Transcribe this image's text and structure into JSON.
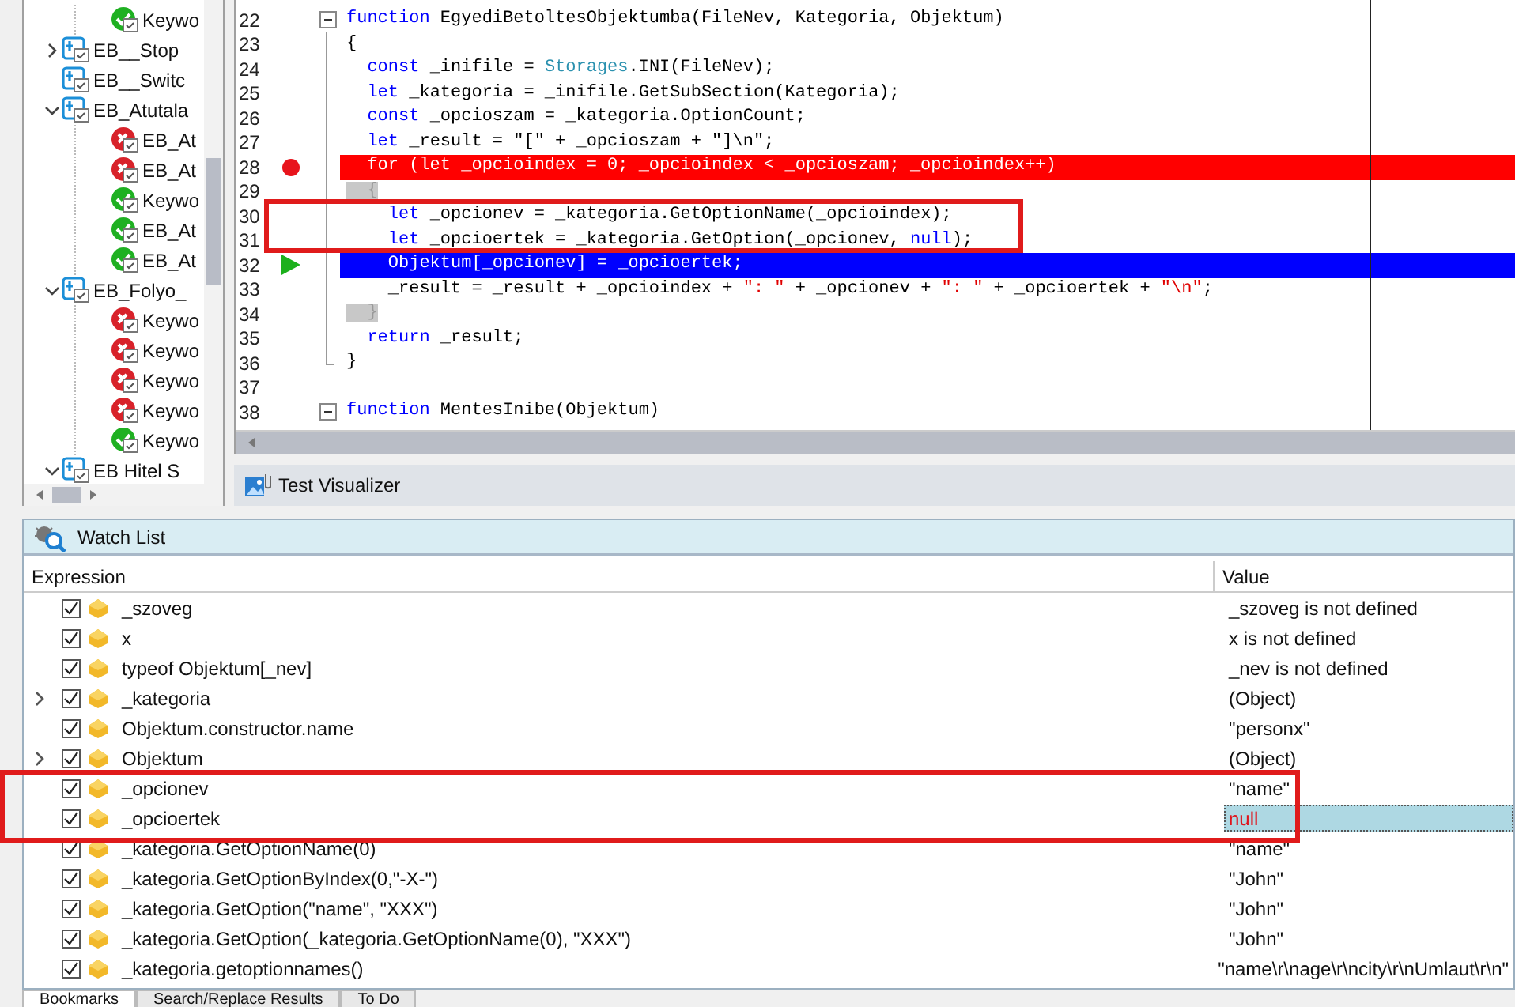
{
  "tree": {
    "continued_children": [
      {
        "label": "Keywo",
        "kind": "test",
        "failed": false
      }
    ],
    "items": [
      {
        "label": "EB__Stop",
        "kind": "group",
        "expanded": false
      },
      {
        "label": "EB__Switc",
        "kind": "group"
      },
      {
        "label": "EB_Atutala",
        "kind": "group",
        "expanded": true,
        "children": [
          {
            "label": "EB_At",
            "kind": "test",
            "failed": true
          },
          {
            "label": "EB_At",
            "kind": "test",
            "failed": true
          },
          {
            "label": "Keywo",
            "kind": "test",
            "failed": false
          },
          {
            "label": "EB_At",
            "kind": "test",
            "failed": false
          },
          {
            "label": "EB_At",
            "kind": "test",
            "failed": false
          }
        ]
      },
      {
        "label": "EB_Folyo_",
        "kind": "group",
        "expanded": true,
        "children": [
          {
            "label": "Keywo",
            "kind": "test",
            "failed": true
          },
          {
            "label": "Keywo",
            "kind": "test",
            "failed": true
          },
          {
            "label": "Keywo",
            "kind": "test",
            "failed": true
          },
          {
            "label": "Keywo",
            "kind": "test",
            "failed": true
          },
          {
            "label": "Keywo",
            "kind": "test",
            "failed": false
          }
        ]
      },
      {
        "label": "EB Hitel S",
        "kind": "group",
        "expanded": true
      }
    ]
  },
  "editor": {
    "lines": [
      {
        "number": "22",
        "fold_start": true,
        "breakpoint": false,
        "current": false,
        "tokens": [
          {
            "kind": "keyword",
            "s": "function"
          },
          {
            "kind": "plain",
            "s": " EgyediBetoltesObjektumba(FileNev, Kategoria, Objektum)"
          }
        ]
      },
      {
        "number": "23",
        "breakpoint": false,
        "current": false,
        "tokens": [
          {
            "kind": "plain",
            "s": "{"
          }
        ]
      },
      {
        "number": "24",
        "breakpoint": false,
        "current": false,
        "tokens": [
          {
            "kind": "keyword",
            "s": "  const"
          },
          {
            "kind": "plain",
            "s": " _inifile = "
          },
          {
            "kind": "type",
            "s": "Storages"
          },
          {
            "kind": "plain",
            "s": ".INI(FileNev);"
          }
        ]
      },
      {
        "number": "25",
        "breakpoint": false,
        "current": false,
        "tokens": [
          {
            "kind": "keyword",
            "s": "  let"
          },
          {
            "kind": "plain",
            "s": " _kategoria = _inifile.GetSubSection(Kategoria);"
          }
        ]
      },
      {
        "number": "26",
        "breakpoint": false,
        "current": false,
        "tokens": [
          {
            "kind": "keyword",
            "s": "  const"
          },
          {
            "kind": "plain",
            "s": " _opcioszam = _kategoria.OptionCount;"
          }
        ]
      },
      {
        "number": "27",
        "breakpoint": false,
        "current": false,
        "tokens": [
          {
            "kind": "keyword",
            "s": "  let"
          },
          {
            "kind": "plain",
            "s": " _result = \"[\" + _opcioszam + \"]\\n\";"
          }
        ]
      },
      {
        "number": "28",
        "breakpoint": true,
        "current": false,
        "tokens": [
          {
            "kind": "plain",
            "s": "  for (let _opcioindex = 0; _opcioindex < _opcioszam; _opcioindex++)"
          }
        ]
      },
      {
        "number": "29",
        "breakpoint": false,
        "current": false,
        "tokens": [
          {
            "kind": "brace",
            "s": "  {"
          }
        ]
      },
      {
        "number": "30",
        "breakpoint": false,
        "current": false,
        "framed": true,
        "tokens": [
          {
            "kind": "keyword",
            "s": "    let"
          },
          {
            "kind": "plain",
            "s": " _opcionev = _kategoria.GetOptionName(_opcioindex);"
          }
        ]
      },
      {
        "number": "31",
        "breakpoint": false,
        "current": false,
        "framed": true,
        "tokens": [
          {
            "kind": "keyword",
            "s": "    let"
          },
          {
            "kind": "plain",
            "s": " _opcioertek = _kategoria.GetOption(_opcionev, "
          },
          {
            "kind": "keyword",
            "s": "null"
          },
          {
            "kind": "plain",
            "s": ");"
          }
        ]
      },
      {
        "number": "32",
        "breakpoint": false,
        "current": true,
        "tokens": [
          {
            "kind": "plain",
            "s": "    Objektum[_opcionev] = _opcioertek;"
          }
        ]
      },
      {
        "number": "33",
        "breakpoint": false,
        "current": false,
        "tokens": [
          {
            "kind": "plain",
            "s": "    _result = _result + _opcioindex + "
          },
          {
            "kind": "string",
            "s": "\": \""
          },
          {
            "kind": "plain",
            "s": " + _opcionev + "
          },
          {
            "kind": "string",
            "s": "\": \""
          },
          {
            "kind": "plain",
            "s": " + _opcioertek + "
          },
          {
            "kind": "string",
            "s": "\"\\n\""
          },
          {
            "kind": "plain",
            "s": ";"
          }
        ]
      },
      {
        "number": "34",
        "breakpoint": false,
        "current": false,
        "tokens": [
          {
            "kind": "brace",
            "s": "  }"
          }
        ]
      },
      {
        "number": "35",
        "breakpoint": false,
        "current": false,
        "tokens": [
          {
            "kind": "keyword",
            "s": "  return"
          },
          {
            "kind": "plain",
            "s": " _result;"
          }
        ]
      },
      {
        "number": "36",
        "fold_end": true,
        "breakpoint": false,
        "current": false,
        "tokens": [
          {
            "kind": "plain",
            "s": "}"
          }
        ]
      },
      {
        "number": "37",
        "breakpoint": false,
        "current": false
      },
      {
        "number": "38",
        "fold_start": true,
        "breakpoint": false,
        "current": false,
        "tokens": [
          {
            "kind": "keyword",
            "s": "function"
          },
          {
            "kind": "plain",
            "s": " MentesInibe(Objektum)"
          }
        ]
      }
    ]
  },
  "visualizer_tab": {
    "label": "Test Visualizer"
  },
  "watch": {
    "title": "Watch List",
    "columns": [
      "Expression",
      "Value"
    ],
    "rows": [
      {
        "expression": "_szoveg",
        "value": "_szoveg is not defined",
        "kind": "text",
        "checked": true,
        "expandable": false,
        "selected": false
      },
      {
        "expression": "x",
        "value": "x is not defined",
        "kind": "text",
        "checked": true,
        "expandable": false,
        "selected": false
      },
      {
        "expression": "typeof Objektum[_nev]",
        "value": "_nev is not defined",
        "kind": "text",
        "checked": true,
        "expandable": false,
        "selected": false
      },
      {
        "expression": "_kategoria",
        "value": "(Object)",
        "kind": "text",
        "checked": true,
        "expandable": true,
        "selected": false
      },
      {
        "expression": "Objektum.constructor.name",
        "value": "\"personx\"",
        "kind": "text",
        "checked": true,
        "expandable": false,
        "selected": false
      },
      {
        "expression": "Objektum",
        "value": "(Object)",
        "kind": "text",
        "checked": true,
        "expandable": true,
        "selected": false
      },
      {
        "expression": "_opcionev",
        "value": "\"name\"",
        "kind": "text",
        "checked": true,
        "expandable": false,
        "selected": false,
        "framed": true
      },
      {
        "expression": "_opcioertek",
        "value": "null",
        "kind": "null",
        "checked": true,
        "expandable": false,
        "selected": true,
        "framed": true
      },
      {
        "expression": "_kategoria.GetOptionName(0)",
        "value": "\"name\"",
        "kind": "text",
        "checked": true,
        "expandable": false,
        "selected": false
      },
      {
        "expression": "_kategoria.GetOptionByIndex(0,\"-X-\")",
        "value": "\"John\"",
        "kind": "text",
        "checked": true,
        "expandable": false,
        "selected": false
      },
      {
        "expression": "_kategoria.GetOption(\"name\", \"XXX\")",
        "value": "\"John\"",
        "kind": "text",
        "checked": true,
        "expandable": false,
        "selected": false
      },
      {
        "expression": "_kategoria.GetOption(_kategoria.GetOptionName(0), \"XXX\")",
        "value": "\"John\"",
        "kind": "text",
        "checked": true,
        "expandable": false,
        "selected": false
      },
      {
        "expression": "_kategoria.getoptionnames()",
        "value": "\"name\\r\\nage\\r\\ncity\\r\\nUmlaut\\r\\n\"",
        "kind": "text",
        "checked": true,
        "expandable": false,
        "selected": false
      }
    ]
  },
  "bottom_tabs": [
    {
      "label": "Bookmarks",
      "selected": true
    },
    {
      "label": "Search/Replace Results",
      "selected": false
    },
    {
      "label": "To Do",
      "selected": false
    }
  ]
}
